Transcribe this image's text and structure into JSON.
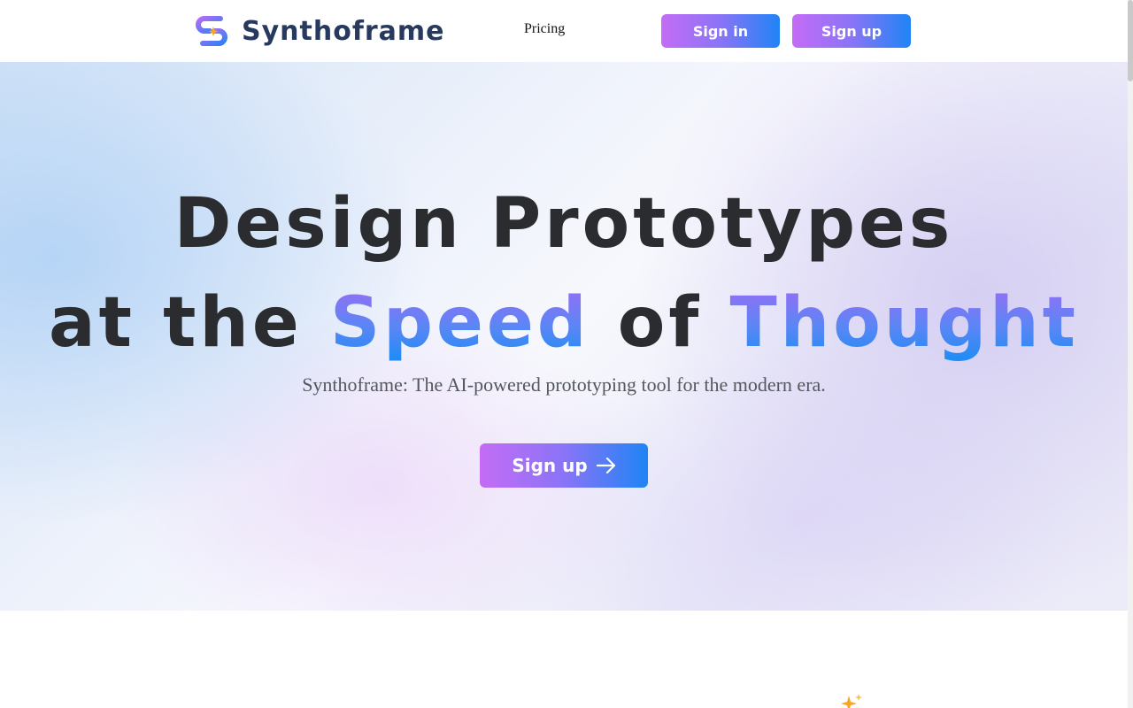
{
  "header": {
    "logo_text": "Synthoframe",
    "nav": {
      "pricing_label": "Pricing"
    },
    "sign_in_label": "Sign in",
    "sign_up_label": "Sign up"
  },
  "hero": {
    "headline_line1": "Design Prototypes",
    "headline_line2_part1": "at the ",
    "headline_line2_highlight1": "Speed",
    "headline_line2_part2": " of ",
    "headline_line2_highlight2": "Thought",
    "subtitle": "Synthoframe: The AI-powered prototyping tool for the modern era.",
    "cta_label": "Sign up",
    "cta_icon": "arrow-right-icon"
  },
  "colors": {
    "brand_gradient_start": "#c46cf5",
    "brand_gradient_end": "#1f84f5",
    "logo_text": "#273a5e",
    "headline": "#2b2c30",
    "sparkle": "#f5a623"
  },
  "icons": {
    "logo": "s-sparkle-logo-icon",
    "sparkle": "sparkle-icon"
  }
}
